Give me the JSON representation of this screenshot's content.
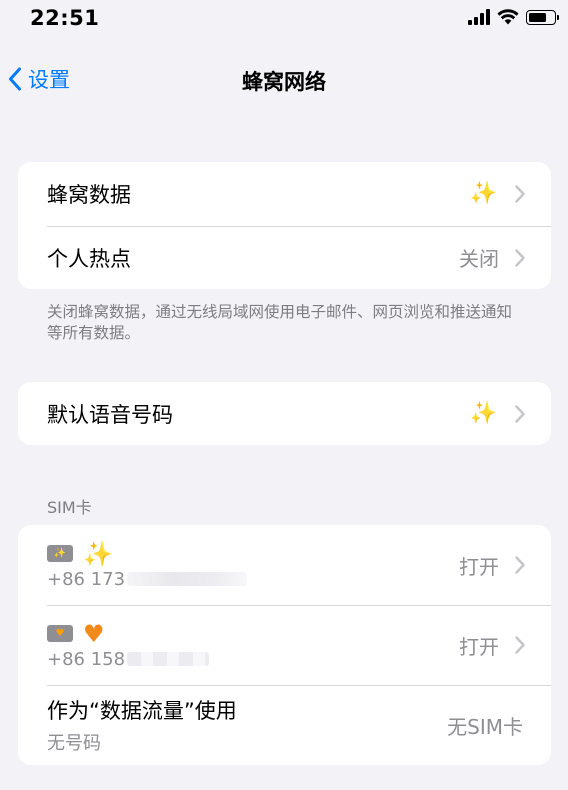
{
  "status": {
    "time": "22:51"
  },
  "nav": {
    "back_label": "设置",
    "title": "蜂窝网络"
  },
  "group1": {
    "rows": [
      {
        "label": "蜂窝数据",
        "icon": "sparkles-emoji"
      },
      {
        "label": "个人热点",
        "value": "关闭"
      }
    ],
    "footer": "关闭蜂窝数据，通过无线局域网使用电子邮件、网页浏览和推送通知等所有数据。"
  },
  "group2": {
    "rows": [
      {
        "label": "默认语音号码",
        "icon": "sparkles-emoji"
      }
    ]
  },
  "sim_section": {
    "header": "SIM卡",
    "sims": [
      {
        "badge_icon": "sparkles-emoji",
        "number_prefix": "+86 173",
        "status": "打开"
      },
      {
        "badge_icon": "orange-heart-emoji",
        "number_prefix": "+86 158",
        "status": "打开"
      }
    ],
    "data_row": {
      "label": "作为“数据流量”使用",
      "sub": "无号码",
      "value": "无SIM卡"
    }
  },
  "colors": {
    "accent": "#007aff",
    "background": "#f2f2f7",
    "secondary_text": "#8e8e93"
  }
}
